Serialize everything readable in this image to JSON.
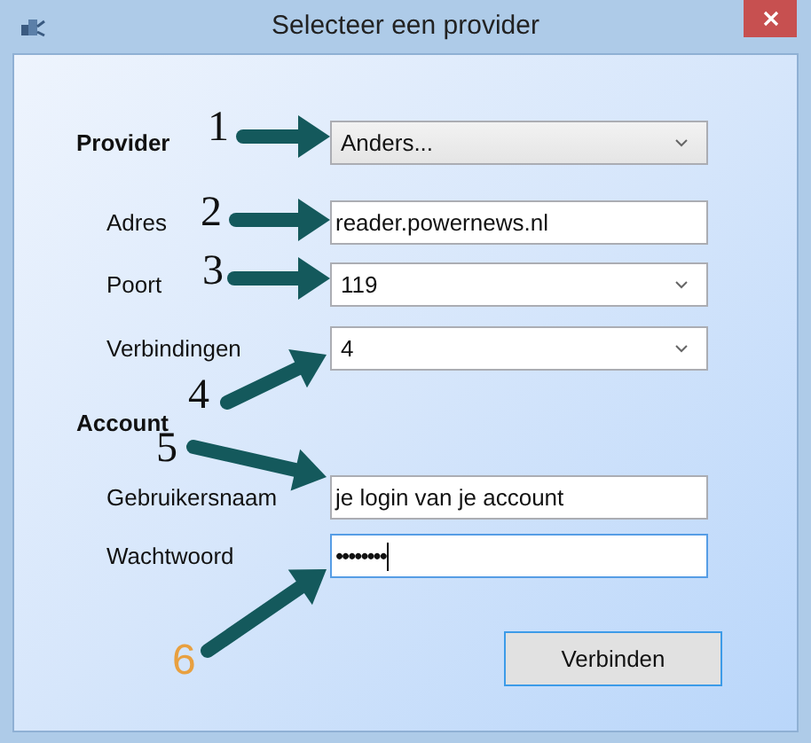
{
  "window": {
    "title": "Selecteer een provider"
  },
  "rows": [
    {
      "kind": "select",
      "label": "Provider",
      "bold": true,
      "value": "Anders...",
      "focused": false
    },
    {
      "kind": "text",
      "label": "Adres",
      "bold": false,
      "value": "reader.powernews.nl",
      "focused": false
    },
    {
      "kind": "select",
      "label": "Poort",
      "bold": false,
      "value": "119",
      "focused": false
    },
    {
      "kind": "select",
      "label": "Verbindingen",
      "bold": false,
      "value": "4",
      "focused": false
    },
    {
      "kind": "heading",
      "label": "Account",
      "bold": true
    },
    {
      "kind": "text",
      "label": "Gebruikersnaam",
      "bold": false,
      "value": "je login van je account",
      "focused": false
    },
    {
      "kind": "password",
      "label": "Wachtwoord",
      "bold": false,
      "value": "••••••••",
      "focused": true
    }
  ],
  "button": {
    "label": "Verbinden",
    "default": true
  },
  "annotations": [
    {
      "number": "1",
      "color": "#111111"
    },
    {
      "number": "2",
      "color": "#111111"
    },
    {
      "number": "3",
      "color": "#111111"
    },
    {
      "number": "4",
      "color": "#111111"
    },
    {
      "number": "5",
      "color": "#111111"
    },
    {
      "number": "6",
      "color": "#e8a040"
    }
  ]
}
